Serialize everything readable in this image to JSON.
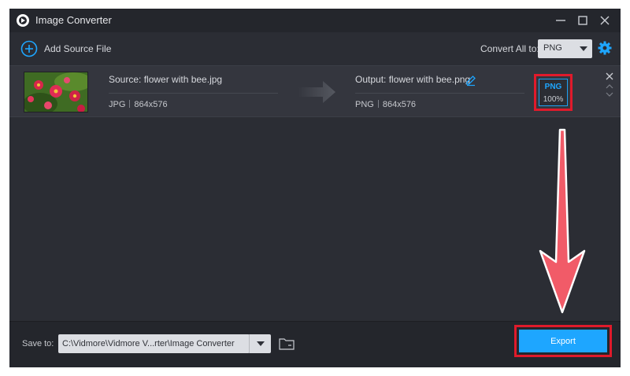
{
  "window": {
    "title": "Image Converter",
    "controls": [
      "minimize-icon",
      "maximize-icon",
      "close-icon"
    ]
  },
  "toolbar": {
    "add_label": "Add Source File",
    "convert_all_label": "Convert All to:",
    "convert_all_value": "PNG",
    "icons": [
      "add-circle-icon",
      "settings-icon"
    ]
  },
  "file": {
    "source_name": "Source: flower with bee.jpg",
    "source_format": "JPG",
    "source_size": "864x576",
    "output_name": "Output: flower with bee.png",
    "output_format": "PNG",
    "output_size": "864x576",
    "badge_format": "PNG",
    "badge_quality": "100%"
  },
  "bottom": {
    "save_label": "Save to:",
    "save_path": "C:\\Vidmore\\Vidmore V...rter\\Image Converter",
    "export_label": "Export"
  },
  "colors": {
    "accent": "#1ea6ff",
    "highlight": "#e01a2b",
    "background": "#2b2d34"
  }
}
